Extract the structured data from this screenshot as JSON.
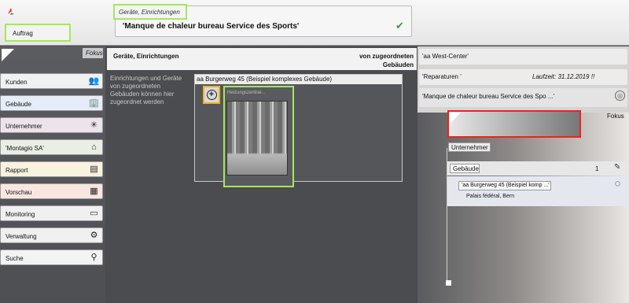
{
  "header": {
    "auftrag_label": "Auftrag",
    "category": "Geräte, Einrichtungen",
    "order_title": "'Manque de chaleur bureau Service des Sports'"
  },
  "sidebar": {
    "fokus_label": "Fokus",
    "items": [
      {
        "label": "Kunden",
        "icon": "users-icon",
        "glyph": "👥",
        "bg": "#f1f1f1"
      },
      {
        "label": "Gebäude",
        "icon": "building-icon",
        "glyph": "🏢",
        "bg": "#e6edf8"
      },
      {
        "label": "Unternehmer",
        "icon": "network-icon",
        "glyph": "✳",
        "bg": "#ece4ea"
      },
      {
        "label": "'Montagio SA'",
        "icon": "home-icon",
        "glyph": "⌂",
        "bg": "#e9efe4"
      },
      {
        "label": "Rapport",
        "icon": "report-icon",
        "glyph": "▤",
        "bg": "#f8f3df"
      },
      {
        "label": "Vorschau",
        "icon": "calendar-icon",
        "glyph": "▦",
        "bg": "#f9e6e0"
      },
      {
        "label": "Monitoring",
        "icon": "monitor-icon",
        "glyph": "▭",
        "bg": "#f0f0f0"
      },
      {
        "label": "Verwaltung",
        "icon": "admin-icon",
        "glyph": "⚙",
        "bg": "#f0f0f0"
      },
      {
        "label": "Suche",
        "icon": "search-icon",
        "glyph": "⚲",
        "bg": "#f3f3f3"
      }
    ]
  },
  "middle": {
    "title": "Geräte, Einrichtungen",
    "right_label": "von zugeordneten Gebäuden",
    "description": "Einrichtungen und Geräte von zugeordneten Gebäuden können hier zugeordnet werden",
    "building_title": "aa Burgerweg 45 (Beispiel komplexes Gebäude)",
    "image_label": "Heizungszentral..."
  },
  "right": {
    "west_center": "'aa West-Center'",
    "reparaturen": "'Reparaturen '",
    "laufzeit": "Laufzeit:  31.12.2019  !!",
    "manque": "'Manque de chaleur bureau Service des Spo ...'",
    "fokus_label": "Fokus",
    "unternehmer_label": "Unternehmer",
    "gebaeude_label": "Gebäude",
    "gebaeude_count": "1",
    "child_title": "'aa Burgerweg 45 (Beispiel komp ...'",
    "child_sub": "Palais fédéral, Bern"
  },
  "colors": {
    "highlight_green": "#a4e85a",
    "highlight_orange": "#f1b31c",
    "highlight_red": "#ee2222",
    "check_green": "#3a9a3a"
  }
}
